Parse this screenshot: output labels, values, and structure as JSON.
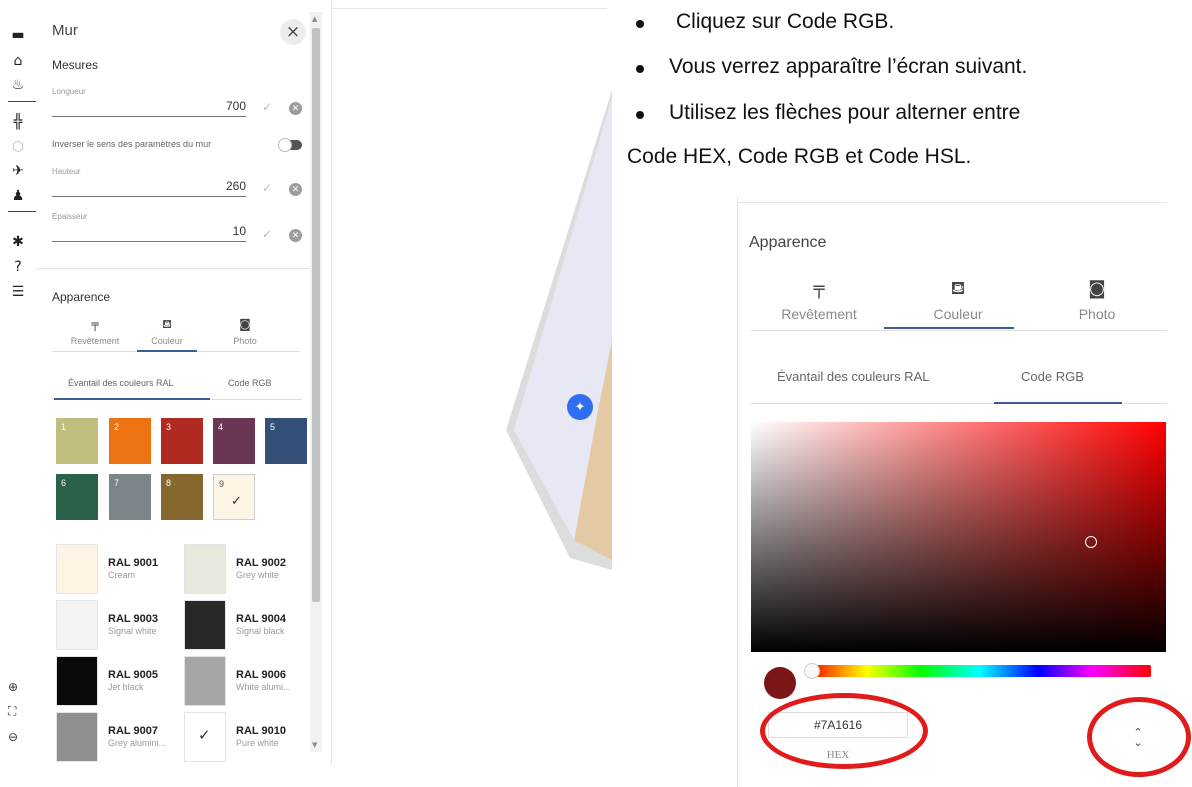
{
  "rail": {
    "icons": [
      "sofa-icon",
      "home-icon",
      "bucket-icon",
      "floorplan-icon",
      "cube-icon",
      "airplane-icon",
      "person-icon",
      "gear-icon",
      "help-icon",
      "list-icon"
    ],
    "zoom": [
      "zoom-in-icon",
      "fit-screen-icon",
      "zoom-out-icon"
    ]
  },
  "panel": {
    "title": "Mur",
    "close_glyph": "×",
    "measures_title": "Mesures",
    "fields": [
      {
        "label": "Longueur",
        "value": "700"
      },
      {
        "label": "Hauteur",
        "value": "260"
      },
      {
        "label": "Epaisseur",
        "value": "10"
      }
    ],
    "invert_label": "Inverser le sens des paramètres du mur",
    "appearance_title": "Apparence",
    "appearance_tabs": [
      {
        "icon": "paint-roller-icon",
        "label": "Revêtement"
      },
      {
        "icon": "paint-bucket-icon",
        "label": "Couleur"
      },
      {
        "icon": "add-photo-icon",
        "label": "Photo"
      }
    ],
    "color_tabs": [
      "Évantail des couleurs RAL",
      "Code RGB"
    ],
    "swatches": [
      {
        "num": "1",
        "color": "#c0bd7e"
      },
      {
        "num": "2",
        "color": "#ec7212"
      },
      {
        "num": "3",
        "color": "#b12a22"
      },
      {
        "num": "4",
        "color": "#6b3654"
      },
      {
        "num": "5",
        "color": "#334f78"
      },
      {
        "num": "6",
        "color": "#2a6149"
      },
      {
        "num": "7",
        "color": "#7a8589"
      },
      {
        "num": "8",
        "color": "#86672e"
      },
      {
        "num": "9",
        "color": "#fcf4e4",
        "selected": true
      }
    ],
    "ral_colors": [
      {
        "code": "RAL 9001",
        "name": "Cream",
        "color": "#fdf4e3"
      },
      {
        "code": "RAL 9002",
        "name": "Grey white",
        "color": "#e6e9dc"
      },
      {
        "code": "RAL 9003",
        "name": "Signal white",
        "color": "#f4f4f4"
      },
      {
        "code": "RAL 9004",
        "name": "Signal black",
        "color": "#282828"
      },
      {
        "code": "RAL 9005",
        "name": "Jet black",
        "color": "#0a0a0a"
      },
      {
        "code": "RAL 9006",
        "name": "White alumi...",
        "color": "#a5a5a5"
      },
      {
        "code": "RAL 9007",
        "name": "Grey alumini...",
        "color": "#8f8f8f"
      },
      {
        "code": "RAL 9010",
        "name": "Pure white",
        "color": "#ffffff",
        "selected": true
      }
    ]
  },
  "instructions": {
    "line1": "Cliquez sur Code RGB.",
    "line2": "Vous verrez apparaître l’écran suivant.",
    "line3a": "Utilisez les flèches pour alterner entre",
    "line3b": "Code HEX, Code RGB et Code HSL."
  },
  "zoomed": {
    "appearance_title": "Apparence",
    "tabs": [
      "Revêtement",
      "Couleur",
      "Photo"
    ],
    "color_tabs": [
      "Évantail des couleurs RAL",
      "Code RGB"
    ],
    "hex_value": "#7A1616",
    "hex_label": "HEX",
    "selected_color": "#7a1616",
    "annotation_color": "#e11b1b"
  }
}
